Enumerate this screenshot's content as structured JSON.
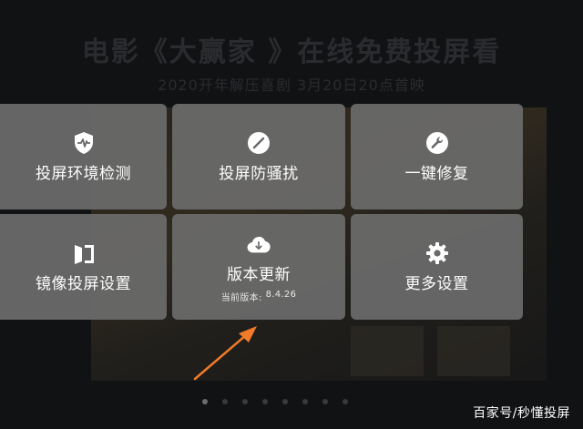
{
  "background": {
    "title": "电影《大赢家 》在线免费投屏看",
    "subtitle": "2020开年解压喜剧  3月20日20点首映"
  },
  "menu": {
    "items": [
      {
        "label": "投屏环境检测",
        "icon": "shield-check-icon"
      },
      {
        "label": "投屏防骚扰",
        "icon": "no-disturb-icon"
      },
      {
        "label": "一键修复",
        "icon": "wrench-icon"
      },
      {
        "label": "镜像投屏设置",
        "icon": "mirror-icon"
      },
      {
        "label": "版本更新",
        "icon": "cloud-download-icon",
        "sub_label": "当前版本:",
        "version": "8.4.26"
      },
      {
        "label": "更多设置",
        "icon": "gear-icon"
      }
    ]
  },
  "carousel": {
    "page_count": 8,
    "active_index": 0
  },
  "watermark": "百家号/秒懂投屏",
  "colors": {
    "tile_bg": "#6a6a6a",
    "accent_arrow": "#f07b28",
    "text": "#ffffff"
  }
}
